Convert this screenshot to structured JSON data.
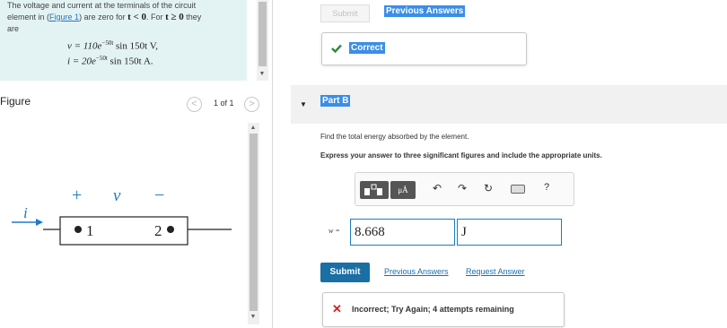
{
  "problem": {
    "text_line1": "The voltage and current at the terminals of the circuit",
    "text_line2_pre": "element in (",
    "figure_link": "Figure 1",
    "text_line2_post": ") are zero for",
    "cond1": "t < 0",
    "text_for": ". For",
    "cond2": "t ≥ 0",
    "text_they": "they",
    "text_line3": "are",
    "eq_v_lhs": "v = 110e",
    "eq_v_exp": "−50t",
    "eq_v_rhs": " sin 150t V,",
    "eq_i_lhs": "i = 20e",
    "eq_i_exp": "−50t",
    "eq_i_rhs": " sin 150t A."
  },
  "figure": {
    "label": "Figure",
    "pager": "1 of 1",
    "prev_symbol": "<",
    "next_symbol": ">",
    "current_label": "i",
    "plus": "+",
    "voltage_label": "v",
    "minus": "−",
    "node1": "1",
    "node2": "2"
  },
  "part_a": {
    "submit_label": "Submit",
    "previous_answers_label": "Previous Answers",
    "correct_label": "Correct"
  },
  "part_b": {
    "title": "Part B",
    "question": "Find the total energy absorbed by the element.",
    "instruction": "Express your answer to three significant figures and include the appropriate units.",
    "var_label": "w =",
    "value": "8.668",
    "units": "J",
    "submit_label": "Submit",
    "previous_answers_label": "Previous Answers",
    "request_answer_label": "Request Answer",
    "feedback": "Incorrect; Try Again; 4 attempts remaining"
  },
  "toolbar": {
    "templates_icon": "templates-icon",
    "units_symbol": "μÅ",
    "undo_icon": "undo-icon",
    "redo_icon": "redo-icon",
    "reset_icon": "reset-icon",
    "keyboard_icon": "keyboard-icon",
    "help_symbol": "?"
  },
  "colors": {
    "problem_bg": "#e3f3f4",
    "accent": "#1a6fa5",
    "correct_green": "#2e8b3a",
    "incorrect_red": "#cc2222",
    "highlight": "#3a8ee6"
  }
}
